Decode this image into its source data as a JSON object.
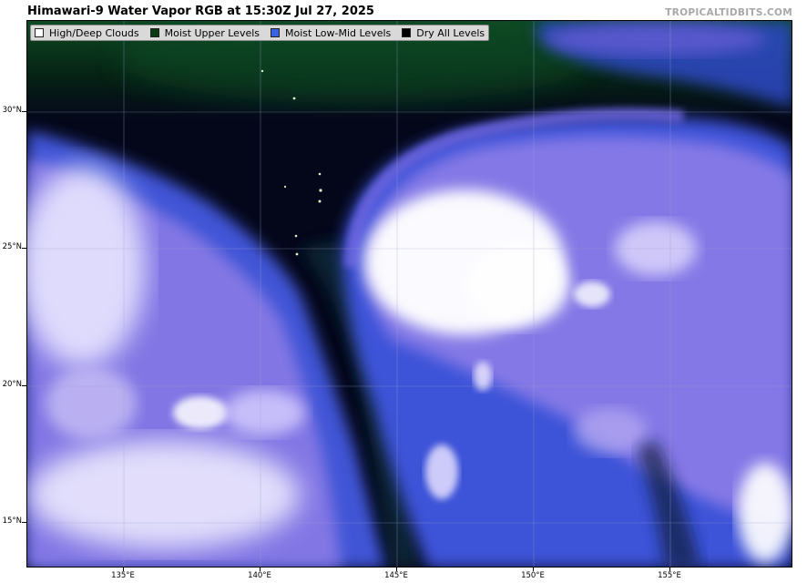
{
  "title": "Himawari-9 Water Vapor RGB at 15:30Z Jul 27, 2025",
  "credit": "TROPICALTIDBITS.COM",
  "legend": [
    {
      "label": "High/Deep Clouds",
      "color": "#ffffff"
    },
    {
      "label": "Moist Upper Levels",
      "color": "#0a3a12"
    },
    {
      "label": "Moist Low-Mid Levels",
      "color": "#3b63e0"
    },
    {
      "label": "Dry All Levels",
      "color": "#000000"
    }
  ],
  "lat_labels": [
    "30°N",
    "25°N",
    "20°N",
    "15°N"
  ],
  "lon_labels": [
    "135°E",
    "140°E",
    "145°E",
    "150°E",
    "155°E"
  ],
  "colors": {
    "dry": "#04071a",
    "moist_upper": "#0a3a12",
    "moist_low_mid": "#3b63e0",
    "cloud_violet": "#9a86e8",
    "deep_cloud": "#ffffff"
  }
}
